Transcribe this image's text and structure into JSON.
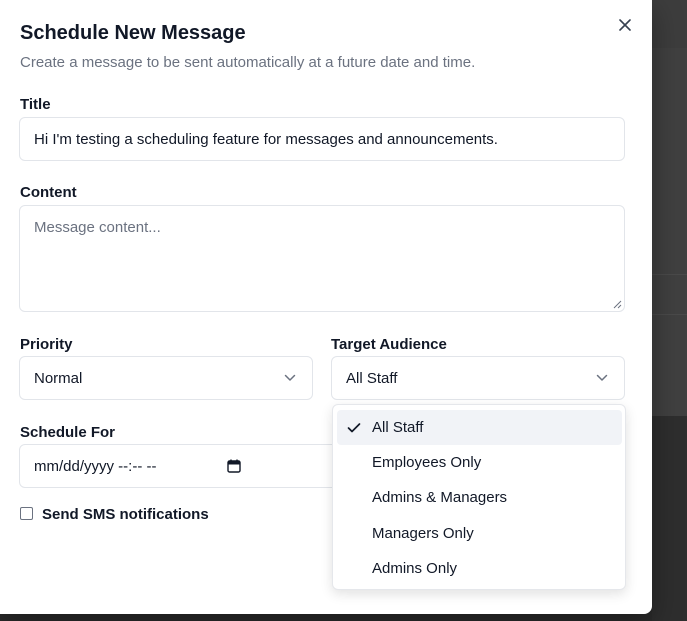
{
  "dialog": {
    "title": "Schedule New Message",
    "subtitle": "Create a message to be sent automatically at a future date and time.",
    "close_icon": "close-icon"
  },
  "form": {
    "title_label": "Title",
    "title_value": "Hi I'm testing a scheduling feature for messages and announcements.",
    "content_label": "Content",
    "content_placeholder": "Message content...",
    "priority_label": "Priority",
    "priority_value": "Normal",
    "audience_label": "Target Audience",
    "audience_value": "All Staff",
    "schedule_label": "Schedule For",
    "schedule_value": "mm/dd/yyyy --:-- --",
    "sms_label": "Send SMS notifications",
    "sms_checked": false
  },
  "audience_dropdown": {
    "selected_index": 0,
    "options": [
      "All Staff",
      "Employees Only",
      "Admins & Managers",
      "Managers Only",
      "Admins Only"
    ]
  },
  "colors": {
    "selected_option_bg": "#f1f3f7",
    "border": "#e2e5ea",
    "muted_text": "#6b7280"
  }
}
